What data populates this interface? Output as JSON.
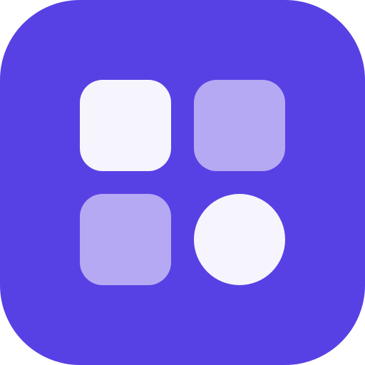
{
  "icon": {
    "name": "app-grid-icon",
    "tile_color": "#5841E4",
    "cells": [
      {
        "name": "grid-cell-top-left",
        "shape": "rounded-square",
        "color": "#F6F5FD"
      },
      {
        "name": "grid-cell-top-right",
        "shape": "rounded-square",
        "color": "#B6A9F3"
      },
      {
        "name": "grid-cell-bottom-left",
        "shape": "rounded-square",
        "color": "#B6A9F3"
      },
      {
        "name": "grid-cell-bottom-right",
        "shape": "circle",
        "color": "#F6F5FD"
      }
    ]
  }
}
